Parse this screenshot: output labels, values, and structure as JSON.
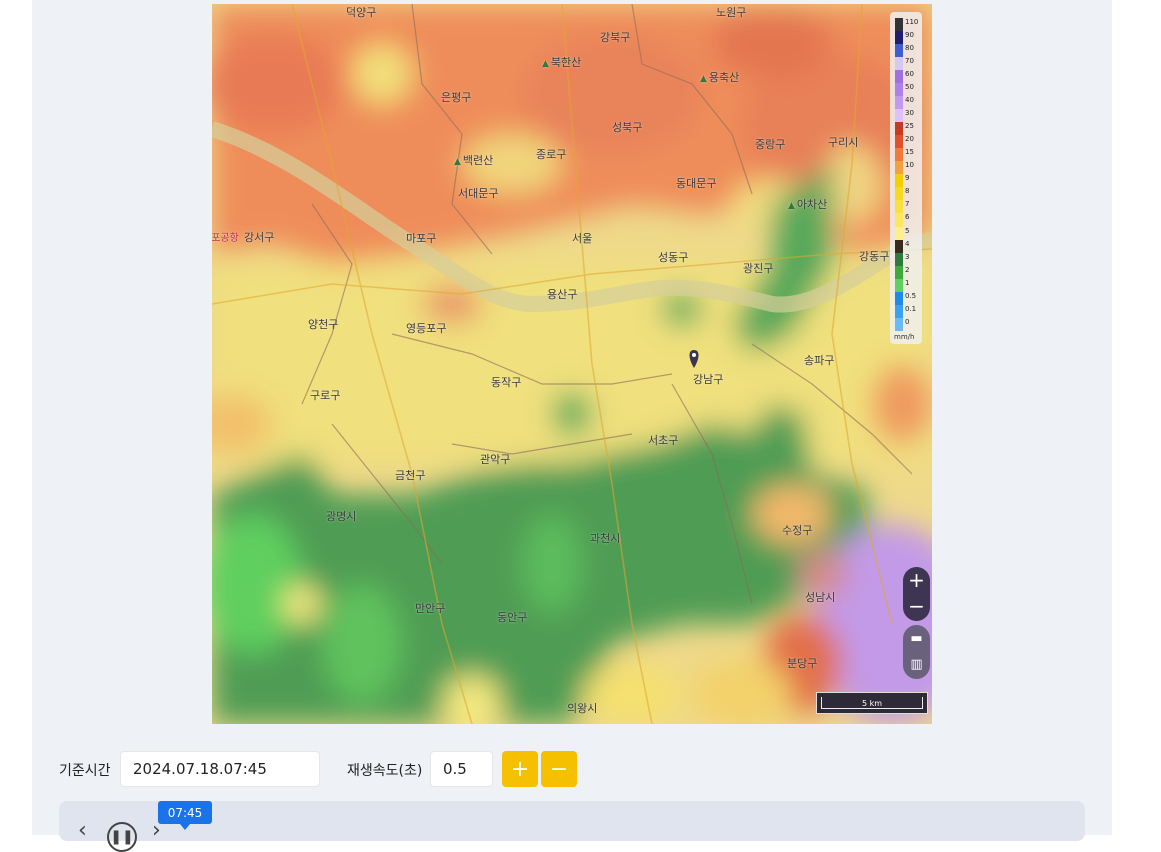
{
  "map": {
    "labels": [
      {
        "id": "dobong",
        "text": "덕양구"
      },
      {
        "id": "nowon",
        "text": "노원구"
      },
      {
        "id": "gangbuk",
        "text": "강북구"
      },
      {
        "id": "bukhansan",
        "text": "북한산",
        "mountain": true
      },
      {
        "id": "eunpyeong",
        "text": "은평구"
      },
      {
        "id": "yongmasan",
        "text": "용축산",
        "mountain": true
      },
      {
        "id": "seongbuk",
        "text": "성북구"
      },
      {
        "id": "jungnang",
        "text": "중랑구"
      },
      {
        "id": "guri",
        "text": "구리시"
      },
      {
        "id": "baengnyeonsan",
        "text": "백련산",
        "mountain": true
      },
      {
        "id": "jongno",
        "text": "종로구"
      },
      {
        "id": "seodaemun",
        "text": "서대문구"
      },
      {
        "id": "dongdaemun",
        "text": "동대문구"
      },
      {
        "id": "achasan",
        "text": "아차산",
        "mountain": true
      },
      {
        "id": "gimpo",
        "text": "김포공항",
        "red": true
      },
      {
        "id": "gangseo",
        "text": "강서구"
      },
      {
        "id": "mapo",
        "text": "마포구"
      },
      {
        "id": "seoul",
        "text": "서울"
      },
      {
        "id": "seongdong",
        "text": "성동구"
      },
      {
        "id": "gwangjin",
        "text": "광진구"
      },
      {
        "id": "gangdong",
        "text": "강동구"
      },
      {
        "id": "yongsan",
        "text": "용산구"
      },
      {
        "id": "yangcheon",
        "text": "양천구"
      },
      {
        "id": "yeongdeungpo",
        "text": "영등포구"
      },
      {
        "id": "gangnam",
        "text": "강남구"
      },
      {
        "id": "songpa",
        "text": "송파구"
      },
      {
        "id": "dongjak",
        "text": "동작구"
      },
      {
        "id": "guro",
        "text": "구로구"
      },
      {
        "id": "seocho",
        "text": "서초구"
      },
      {
        "id": "gwanak",
        "text": "관악구"
      },
      {
        "id": "geumcheon",
        "text": "금천구"
      },
      {
        "id": "gwangmyeong",
        "text": "광명시"
      },
      {
        "id": "gwacheon",
        "text": "과천시"
      },
      {
        "id": "sujeong",
        "text": "수정구"
      },
      {
        "id": "seongnam",
        "text": "성남시"
      },
      {
        "id": "manan",
        "text": "만안구"
      },
      {
        "id": "dongan",
        "text": "동안구"
      },
      {
        "id": "bundang",
        "text": "분당구"
      },
      {
        "id": "uiwang",
        "text": "의왕시"
      }
    ],
    "legend": {
      "labels": [
        "110",
        "90",
        "80",
        "70",
        "60",
        "50",
        "40",
        "30",
        "25",
        "20",
        "15",
        "10",
        "9",
        "8",
        "7",
        "6",
        "5",
        "4",
        "3",
        "2",
        "1",
        "0.5",
        "0.1",
        "0"
      ],
      "colors": [
        "#333333",
        "#1f1f6e",
        "#3f5fd0",
        "#d7c8f0",
        "#a070e0",
        "#b080ea",
        "#c598f0",
        "#e0c0f8",
        "#c83a1f",
        "#e0502a",
        "#ef7a3a",
        "#f4a040",
        "#f5d000",
        "#f7da20",
        "#f9e040",
        "#fbe860",
        "#fdf08a",
        "#3a2a1e",
        "#2f7a3d",
        "#3faa3a",
        "#5fd060",
        "#1e8ae8",
        "#3aa0f0",
        "#6ab8f5"
      ],
      "unit": "mm/h"
    },
    "scale": "5 km"
  },
  "controls": {
    "base_time_label": "기준시간",
    "base_time_value": "2024.07.18.07:45",
    "speed_label": "재생속도(초)",
    "speed_value": "0.5",
    "plus": "+",
    "minus": "−"
  },
  "timeline": {
    "current_time": "07:45"
  }
}
